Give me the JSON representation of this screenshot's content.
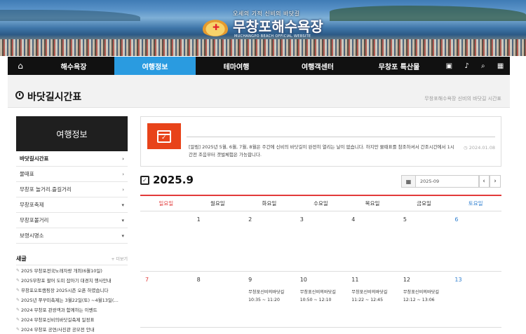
{
  "banner": {
    "tagline": "오세의 기적 신비의 바닷길",
    "site_name": "무창포해수욕장",
    "site_name_en": "MUCHANGPO BEACH OFFICIAL WEBSITE"
  },
  "nav": {
    "home_icon": "home-icon",
    "items": [
      {
        "label": "해수욕장",
        "active": false
      },
      {
        "label": "여행정보",
        "active": true
      },
      {
        "label": "테마여행",
        "active": false
      },
      {
        "label": "여행객센터",
        "active": false
      },
      {
        "label": "무창포 특산물",
        "active": false
      }
    ],
    "icons": [
      "bag-icon",
      "bell-icon",
      "search-icon",
      "grid-menu-icon"
    ],
    "active_color": "#2a9be0"
  },
  "page": {
    "title": "바닷길시간표",
    "breadcrumb": "무창포해수욕장 신비의 바닷길 시간표"
  },
  "sidebar": {
    "header": "여행정보",
    "items": [
      {
        "label": "바닷길시간표",
        "arrow": "›"
      },
      {
        "label": "물때표",
        "arrow": "›"
      },
      {
        "label": "무창포 놀거리.즐길거리",
        "arrow": "›"
      },
      {
        "label": "무창포축제",
        "arrow": "▾"
      },
      {
        "label": "무창포볼거리",
        "arrow": "▾"
      },
      {
        "label": "보령시명소",
        "arrow": "▾"
      }
    ]
  },
  "news": {
    "title": "새글",
    "more": "+ 더보기",
    "items": [
      "2025 무창포전국노래자랑 개최(6월10일)",
      "2025무창포 팔어 도미 잡아기 대경치 행사안내",
      "무창포오토캠핑장 2025시즌 오픈 하였습니다",
      "2025년 쭈꾸미축제는 3월22일(토) ~4월13일(…",
      "2024 무창포 관광객과 함께하는 이벤트",
      "2024 무창포신비의바닷길축제 일정표",
      "2024 무창포 공연/사진관 공모전 안내"
    ]
  },
  "notice": {
    "text": "[알림] 2025년 5월, 6월, 7월, 8월은 주간에 신비의 바닷길이 완전히 열리는 날이 없습니다. 하지만 물때표를 참조하셔서 간조시간에서 1시간전 조음부터 갯벌체험은 가능합니다.",
    "date": "2024.01.08",
    "accent": "#e8431a"
  },
  "calendar": {
    "year_month": "2025.9",
    "picker_value": "2025-09",
    "weekdays": [
      "일요일",
      "월요일",
      "화요일",
      "수요일",
      "목요일",
      "금요일",
      "토요일"
    ],
    "rows": [
      [
        "",
        "1",
        "2",
        "3",
        "4",
        "5",
        "6"
      ],
      [
        "7",
        "8",
        "9",
        "10",
        "11",
        "12",
        "13"
      ]
    ],
    "events": {
      "9": {
        "label": "무창포신비의바닷길",
        "time": "10:35 ~ 11:20"
      },
      "10": {
        "label": "무창포신비의바닷길",
        "time": "10:50 ~ 12:10"
      },
      "11": {
        "label": "무창포신비의바닷길",
        "time": "11:22 ~ 12:45"
      },
      "12": {
        "label": "무창포신비의바닷길",
        "time": "12:12 ~ 13:06"
      }
    },
    "sunday_color": "#e23a3a",
    "saturday_color": "#2f7fd0"
  }
}
